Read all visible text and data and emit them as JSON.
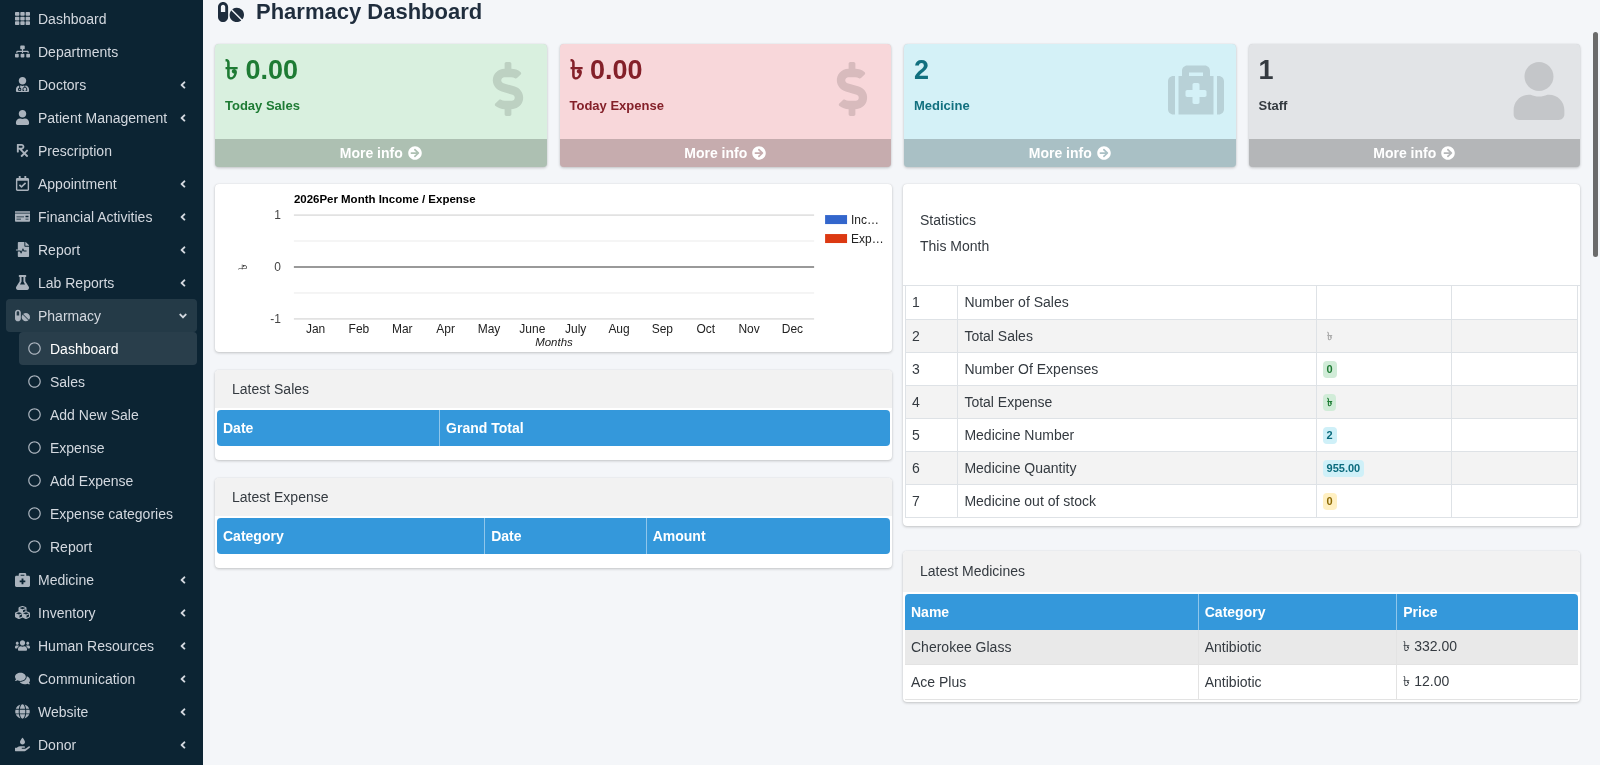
{
  "sidebar": {
    "items": [
      {
        "label": "Dashboard",
        "selected": false
      },
      {
        "label": "Departments",
        "selected": false
      },
      {
        "label": "Doctors",
        "selected": false,
        "expanded": false
      },
      {
        "label": "Patient Management",
        "selected": false,
        "expanded": false
      },
      {
        "label": "Prescription",
        "selected": false
      },
      {
        "label": "Appointment",
        "selected": false,
        "expanded": false
      },
      {
        "label": "Financial Activities",
        "selected": false,
        "expanded": false
      },
      {
        "label": "Report",
        "selected": false,
        "expanded": false
      },
      {
        "label": "Lab Reports",
        "selected": false,
        "expanded": false
      },
      {
        "label": "Pharmacy",
        "selected": true,
        "expanded": true,
        "children": [
          {
            "label": "Dashboard",
            "selected": true
          },
          {
            "label": "Sales",
            "selected": false
          },
          {
            "label": "Add New Sale",
            "selected": false
          },
          {
            "label": "Expense",
            "selected": false
          },
          {
            "label": "Add Expense",
            "selected": false
          },
          {
            "label": "Expense categories",
            "selected": false
          },
          {
            "label": "Report",
            "selected": false
          }
        ]
      },
      {
        "label": "Medicine",
        "selected": false,
        "expanded": false
      },
      {
        "label": "Inventory",
        "selected": false,
        "expanded": false
      },
      {
        "label": "Human Resources",
        "selected": false,
        "expanded": false
      },
      {
        "label": "Communication",
        "selected": false,
        "expanded": false
      },
      {
        "label": "Website",
        "selected": false,
        "expanded": false
      },
      {
        "label": "Donor",
        "selected": false,
        "expanded": false
      }
    ]
  },
  "page": {
    "title": "Pharmacy Dashboard"
  },
  "cards": [
    {
      "kind": "success",
      "value": "৳ 0.00",
      "label": "Today Sales",
      "link": "More info"
    },
    {
      "kind": "danger",
      "value": "৳ 0.00",
      "label": "Today Expense",
      "link": "More info"
    },
    {
      "kind": "info",
      "value": "2",
      "label": "Medicine",
      "link": "More info"
    },
    {
      "kind": "secondary",
      "value": "1",
      "label": "Staff",
      "link": "More info"
    }
  ],
  "income_chart": {
    "chart_data": {
      "type": "bar",
      "title": "2026Per Month Income / Expense",
      "xlabel": "Months",
      "ylabel": "৳",
      "categories": [
        "Jan",
        "Feb",
        "Mar",
        "Apr",
        "May",
        "June",
        "July",
        "Aug",
        "Sep",
        "Oct",
        "Nov",
        "Dec"
      ],
      "series": [
        {
          "name": "Inc…",
          "color": "#3366cc",
          "values": [
            0,
            0,
            0,
            0,
            0,
            0,
            0,
            0,
            0,
            0,
            0,
            0
          ]
        },
        {
          "name": "Exp…",
          "color": "#dc3912",
          "values": [
            0,
            0,
            0,
            0,
            0,
            0,
            0,
            0,
            0,
            0,
            0,
            0
          ]
        }
      ],
      "ylim": [
        -1,
        1
      ],
      "yticks": [
        -1,
        0,
        1
      ],
      "ref_lines": [
        {
          "axis": "y",
          "value": -0.5
        },
        {
          "axis": "y",
          "value": 0.5
        }
      ]
    }
  },
  "latest_sales": {
    "title": "Latest Sales",
    "columns": [
      "Date",
      "Grand Total"
    ]
  },
  "latest_expense": {
    "title": "Latest Expense",
    "columns": [
      "Category",
      "Date",
      "Amount"
    ]
  },
  "statistics": {
    "title": "Statistics",
    "subtitle": "This Month",
    "rows": [
      {
        "number": "1",
        "label": "Number of Sales"
      },
      {
        "number": "2",
        "label": "Total Sales",
        "value": "৳",
        "kind": "plain"
      },
      {
        "number": "3",
        "label": "Number Of Expenses",
        "value": "0",
        "kind": "success"
      },
      {
        "number": "4",
        "label": "Total Expense",
        "value": "৳",
        "kind": "success"
      },
      {
        "number": "5",
        "label": "Medicine Number",
        "value": "2",
        "kind": "info"
      },
      {
        "number": "6",
        "label": "Medicine Quantity",
        "value": "955.00",
        "kind": "info"
      },
      {
        "number": "7",
        "label": "Medicine out of stock",
        "value": "0",
        "kind": "warning"
      }
    ]
  },
  "latest_medicines": {
    "title": "Latest Medicines",
    "columns": [
      "Name",
      "Category",
      "Price"
    ],
    "rows": [
      [
        "Cherokee Glass",
        "Antibiotic",
        "৳ 332.00"
      ],
      [
        "Ace Plus",
        "Antibiotic",
        "৳ 12.00"
      ]
    ]
  }
}
